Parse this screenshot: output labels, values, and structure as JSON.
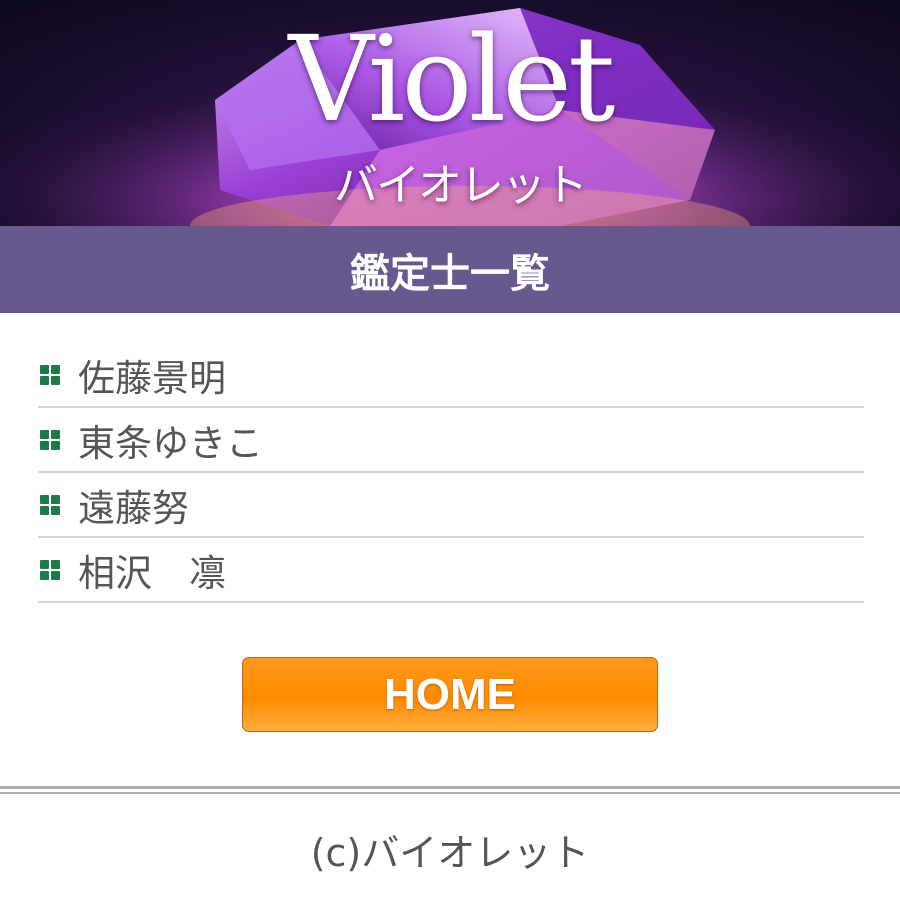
{
  "banner": {
    "logo_en": "Violet",
    "logo_jp": "バイオレット"
  },
  "page": {
    "title": "鑑定士一覧"
  },
  "fortune_tellers": [
    {
      "name": "佐藤景明"
    },
    {
      "name": "東条ゆきこ"
    },
    {
      "name": "遠藤努"
    },
    {
      "name": "相沢　凛"
    }
  ],
  "home_button": {
    "label": "HOME"
  },
  "footer": {
    "copyright": "(c)バイオレット"
  },
  "colors": {
    "title_bar": "#67588e",
    "home_button": "#ff8a00",
    "bullet": "#1f7a4a"
  }
}
